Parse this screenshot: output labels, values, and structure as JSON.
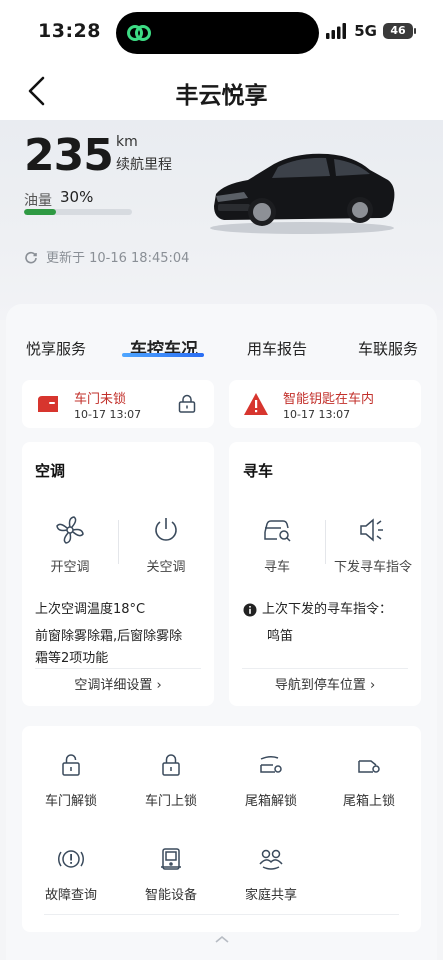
{
  "status_bar": {
    "time": "13:28",
    "network": "5G",
    "battery": "46"
  },
  "nav": {
    "title": "丰云悦享"
  },
  "vehicle": {
    "range_value": "235",
    "range_unit": "km",
    "range_label": "续航里程",
    "fuel_label": "油量",
    "fuel_value": "30%",
    "fuel_fraction": 0.3,
    "update_text": "更新于 10-16 18:45:04"
  },
  "tabs": [
    "悦享服务",
    "车控车况",
    "用车报告",
    "车联服务"
  ],
  "active_tab": 1,
  "alerts": [
    {
      "title": "车门未锁",
      "time": "10-17 13:07"
    },
    {
      "title": "智能钥匙在车内",
      "time": "10-17 13:07"
    }
  ],
  "ac_card": {
    "title": "空调",
    "on_label": "开空调",
    "off_label": "关空调",
    "last_temp": "上次空调温度18°C",
    "desc_line1": "前窗除雾除霜,后窗除雾除",
    "desc_line2": "霜等2项功能",
    "detail_link": "空调详细设置 ›"
  },
  "find_card": {
    "title": "寻车",
    "find_label": "寻车",
    "send_label": "下发寻车指令",
    "last_cmd": "上次下发的寻车指令：",
    "cmd_value": "鸣笛",
    "nav_link": "导航到停车位置 ›"
  },
  "grid": [
    {
      "label": "车门解锁",
      "icon": "unlock-icon"
    },
    {
      "label": "车门上锁",
      "icon": "lock-icon"
    },
    {
      "label": "尾箱解锁",
      "icon": "trunk-unlock-icon"
    },
    {
      "label": "尾箱上锁",
      "icon": "trunk-lock-icon"
    },
    {
      "label": "故障查询",
      "icon": "fault-icon"
    },
    {
      "label": "智能设备",
      "icon": "device-icon"
    },
    {
      "label": "家庭共享",
      "icon": "family-icon"
    }
  ],
  "colors": {
    "accent": "#2a6df3",
    "alert": "#c2302b",
    "fuel": "#2f9a43",
    "icon": "#3a4a5c"
  }
}
